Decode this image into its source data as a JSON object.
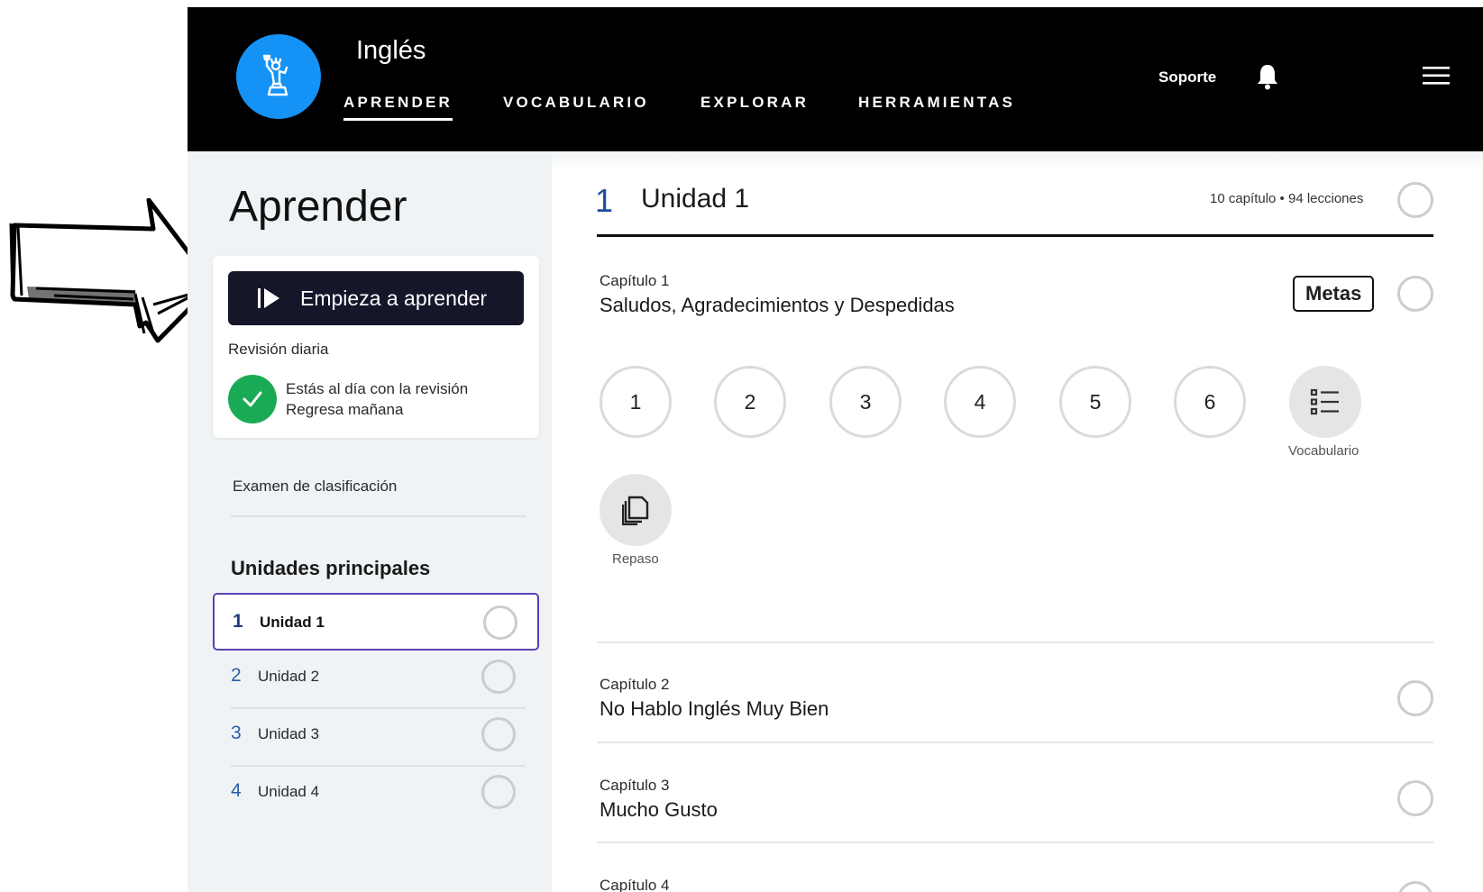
{
  "header": {
    "language_title": "Inglés",
    "nav": [
      "APRENDER",
      "VOCABULARIO",
      "EXPLORAR",
      "HERRAMIENTAS"
    ],
    "active_nav": "APRENDER",
    "support_label": "Soporte",
    "icons": [
      "statue-of-liberty-icon",
      "bell-icon",
      "hamburger-menu-icon"
    ],
    "brand_color": "#1592f5"
  },
  "sidebar": {
    "title": "Aprender",
    "start_button_label": "Empieza a aprender",
    "daily_review_label": "Revisión diaria",
    "review_status_line1": "Estás al día con la revisión",
    "review_status_line2": "Regresa mañana",
    "placement_exam_label": "Examen de clasificación",
    "units_heading": "Unidades principales",
    "units": [
      {
        "num": "1",
        "name": "Unidad 1",
        "selected": true
      },
      {
        "num": "2",
        "name": "Unidad 2",
        "selected": false
      },
      {
        "num": "3",
        "name": "Unidad 3",
        "selected": false
      },
      {
        "num": "4",
        "name": "Unidad 4",
        "selected": false
      }
    ],
    "status_color": "#1aaa55",
    "selected_border_color": "#5b40b8"
  },
  "main": {
    "unit_num": "1",
    "unit_title": "Unidad 1",
    "unit_meta": "10 capítulo • 94 lecciones",
    "chapters": [
      {
        "label": "Capítulo 1",
        "title": "Saludos, Agradecimientos y Despedidas"
      },
      {
        "label": "Capítulo 2",
        "title": "No Hablo Inglés Muy Bien"
      },
      {
        "label": "Capítulo 3",
        "title": "Mucho Gusto"
      },
      {
        "label": "Capítulo 4",
        "title": ""
      }
    ],
    "metas_label": "Metas",
    "lessons": [
      "1",
      "2",
      "3",
      "4",
      "5",
      "6"
    ],
    "vocab_label": "Vocabulario",
    "review_label": "Repaso"
  }
}
